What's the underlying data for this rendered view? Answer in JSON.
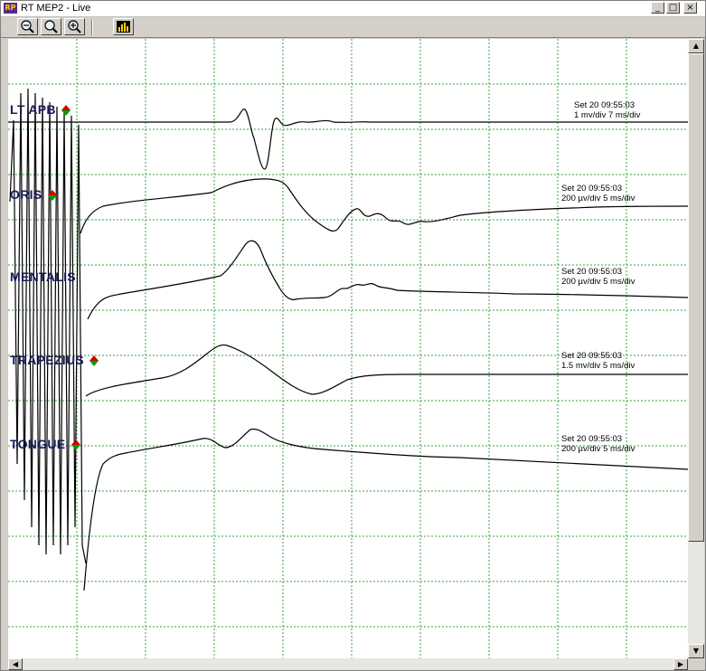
{
  "window": {
    "title": "RT MEP2 - Live",
    "icon_label": "RP",
    "controls": [
      "_",
      "□",
      "×"
    ]
  },
  "toolbar": {
    "buttons": [
      {
        "name": "zoom-fit-icon"
      },
      {
        "name": "zoom-out-icon"
      },
      {
        "name": "zoom-in-icon"
      },
      {
        "name": "bar-chart-icon"
      }
    ]
  },
  "colors": {
    "grid": "#3aa03a",
    "trace": "#000000",
    "label": "#1a1a5a",
    "arrow_up": "#d00000",
    "arrow_down": "#00a000"
  },
  "channels": [
    {
      "label": "LT APB",
      "timestamp": "Set 20 09:55:03",
      "scale": "1 mv/div 7 ms/div"
    },
    {
      "label": "ORIS",
      "timestamp": "Set 20 09:55:03",
      "scale": "200 µv/div 5 ms/div"
    },
    {
      "label": "MENTALIS",
      "timestamp": "Set 20 09:55:03",
      "scale": "200 µv/div 5 ms/div"
    },
    {
      "label": "TRAPEZIUS",
      "timestamp": "Set 20 09:55:03",
      "scale": "1.5 mv/div 5 ms/div"
    },
    {
      "label": "TONGUE",
      "timestamp": "Set 20 09:55:03",
      "scale": "200 µv/div 5 ms/div"
    }
  ]
}
